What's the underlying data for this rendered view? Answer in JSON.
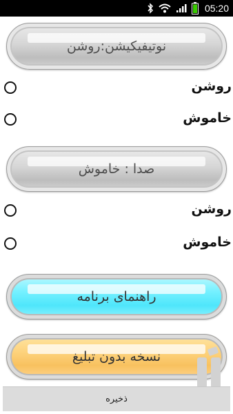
{
  "status_bar": {
    "icons": [
      "bluetooth-icon",
      "wifi-icon",
      "signal-icon",
      "battery-icon"
    ],
    "time": "05:20"
  },
  "notification_section": {
    "button_label": "نوتیفیکیشن:روشن",
    "options": [
      {
        "label": "روشن",
        "selected": false
      },
      {
        "label": "خاموش",
        "selected": false
      }
    ]
  },
  "sound_section": {
    "button_label": "صدا : خاموش",
    "options": [
      {
        "label": "روشن",
        "selected": false
      },
      {
        "label": "خاموش",
        "selected": false
      }
    ]
  },
  "guide_button": {
    "label": "راهنمای برنامه",
    "color": "#5ee9fd"
  },
  "adfree_button": {
    "label": "نسخه بدون تبلیغ",
    "color": "#fbcd72"
  },
  "save_button": {
    "label": "ذخیره"
  },
  "colors": {
    "status_bar": "#000000",
    "background": "#ffffff",
    "save_bar": "#dcdcdc"
  }
}
